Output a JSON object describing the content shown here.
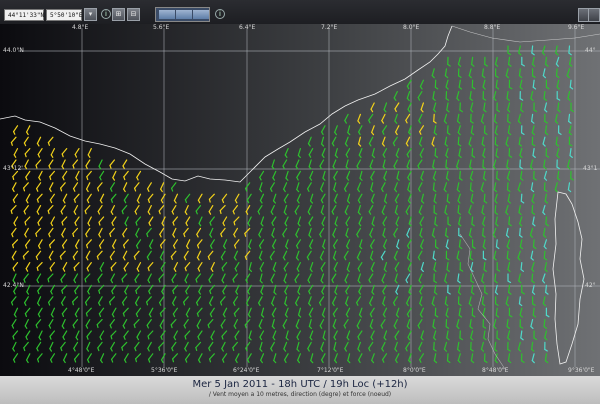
{
  "toolbar": {
    "latitude_value": "44°11'33\"N",
    "longitude_value": "5°50'10\"E",
    "info_glyph": "i",
    "buttons": [
      {
        "name": "chevron-down-icon",
        "glyph": "▾"
      },
      {
        "name": "grid-icon",
        "glyph": "⊞"
      },
      {
        "name": "minus-icon",
        "glyph": "⊟"
      }
    ]
  },
  "map": {
    "top_lon_labels": [
      "4.8°E",
      "5.6°E",
      "6.4°E",
      "7.2°E",
      "8.0°E",
      "8.8°E",
      "9.6°E"
    ],
    "bottom_lon_labels": [
      "4°48'0\"E",
      "5°36'0\"E",
      "6°24'0\"E",
      "7°12'0\"E",
      "8°0'0\"E",
      "8°48'0\"E",
      "9°36'0\"E"
    ],
    "left_lat_labels": [
      "44.0°N",
      "43°12'",
      "42.4°N"
    ],
    "right_lat_labels": [
      "44°",
      "43°1",
      "42°"
    ],
    "wind_colors": {
      "strong": "#f2d21a",
      "moderate": "#2ec02e",
      "light": "#4fd9c9"
    },
    "coast_color": "#f2f2f2",
    "grid_color": "#aeb2b8"
  },
  "footer": {
    "title": "Mer 5 Jan 2011 - 18h UTC / 19h Loc (+12h)",
    "subtitle": "/ Vent moyen a 10 metres, direction (degre) et force (noeud)"
  }
}
